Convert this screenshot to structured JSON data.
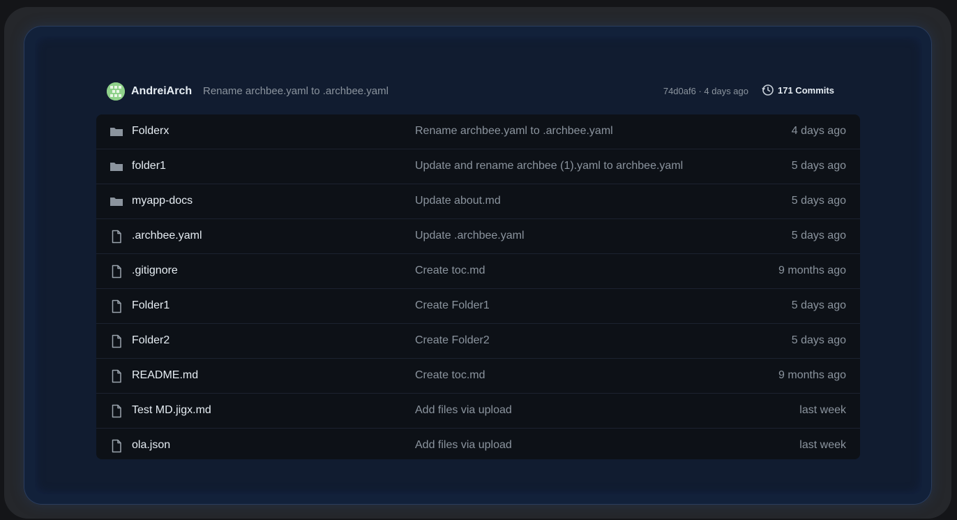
{
  "latest_commit": {
    "author": "AndreiArch",
    "message": "Rename archbee.yaml to .archbee.yaml",
    "meta": "74d0af6 · 4 days ago",
    "commits_label": "171 Commits",
    "avatar_color": "#8fd18a"
  },
  "files": [
    {
      "type": "folder",
      "icon": "folder-icon",
      "name": "Folderx",
      "message": "Rename archbee.yaml to .archbee.yaml",
      "date": "4 days ago"
    },
    {
      "type": "folder",
      "icon": "folder-icon",
      "name": "folder1",
      "message": "Update and rename archbee (1).yaml to archbee.yaml",
      "date": "5 days ago"
    },
    {
      "type": "folder",
      "icon": "folder-icon",
      "name": "myapp-docs",
      "message": "Update about.md",
      "date": "5 days ago"
    },
    {
      "type": "file",
      "icon": "file-icon",
      "name": ".archbee.yaml",
      "message": "Update .archbee.yaml",
      "date": "5 days ago"
    },
    {
      "type": "file",
      "icon": "file-icon",
      "name": ".gitignore",
      "message": "Create toc.md",
      "date": "9 months ago"
    },
    {
      "type": "file",
      "icon": "file-icon",
      "name": "Folder1",
      "message": "Create Folder1",
      "date": "5 days ago"
    },
    {
      "type": "file",
      "icon": "file-icon",
      "name": "Folder2",
      "message": "Create Folder2",
      "date": "5 days ago"
    },
    {
      "type": "file",
      "icon": "file-icon",
      "name": "README.md",
      "message": "Create toc.md",
      "date": "9 months ago"
    },
    {
      "type": "file",
      "icon": "file-icon",
      "name": "Test MD.jigx.md",
      "message": "Add files via upload",
      "date": "last week"
    },
    {
      "type": "file",
      "icon": "file-icon",
      "name": "ola.json",
      "message": "Add files via upload",
      "date": "last week"
    }
  ]
}
